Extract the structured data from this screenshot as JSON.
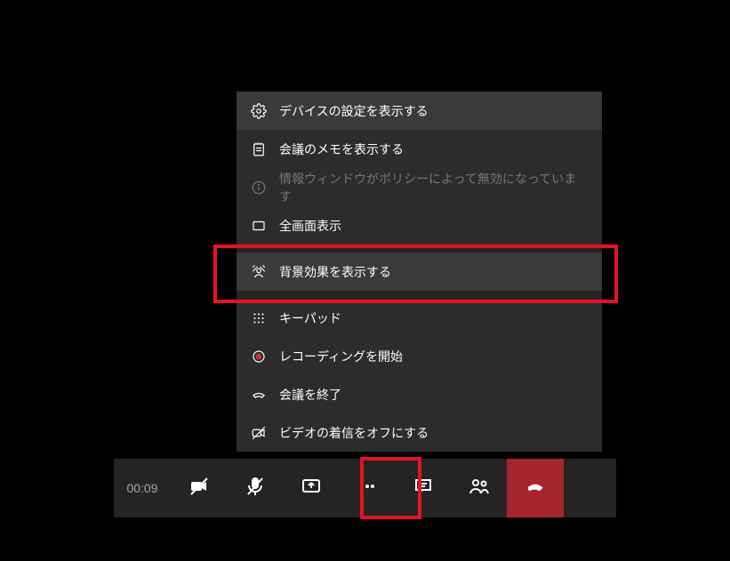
{
  "toolbar": {
    "timer": "00:09"
  },
  "menu": {
    "device_settings": "デバイスの設定を表示する",
    "meeting_notes": "会議のメモを表示する",
    "info_disabled": "情報ウィンドウがポリシーによって無効になっています",
    "fullscreen": "全画面表示",
    "background_effects": "背景効果を表示する",
    "keypad": "キーパッド",
    "start_recording": "レコーディングを開始",
    "end_meeting": "会議を終了",
    "video_incoming_off": "ビデオの着信をオフにする"
  },
  "colors": {
    "highlight": "#e81123",
    "hangup": "#a4262c"
  }
}
